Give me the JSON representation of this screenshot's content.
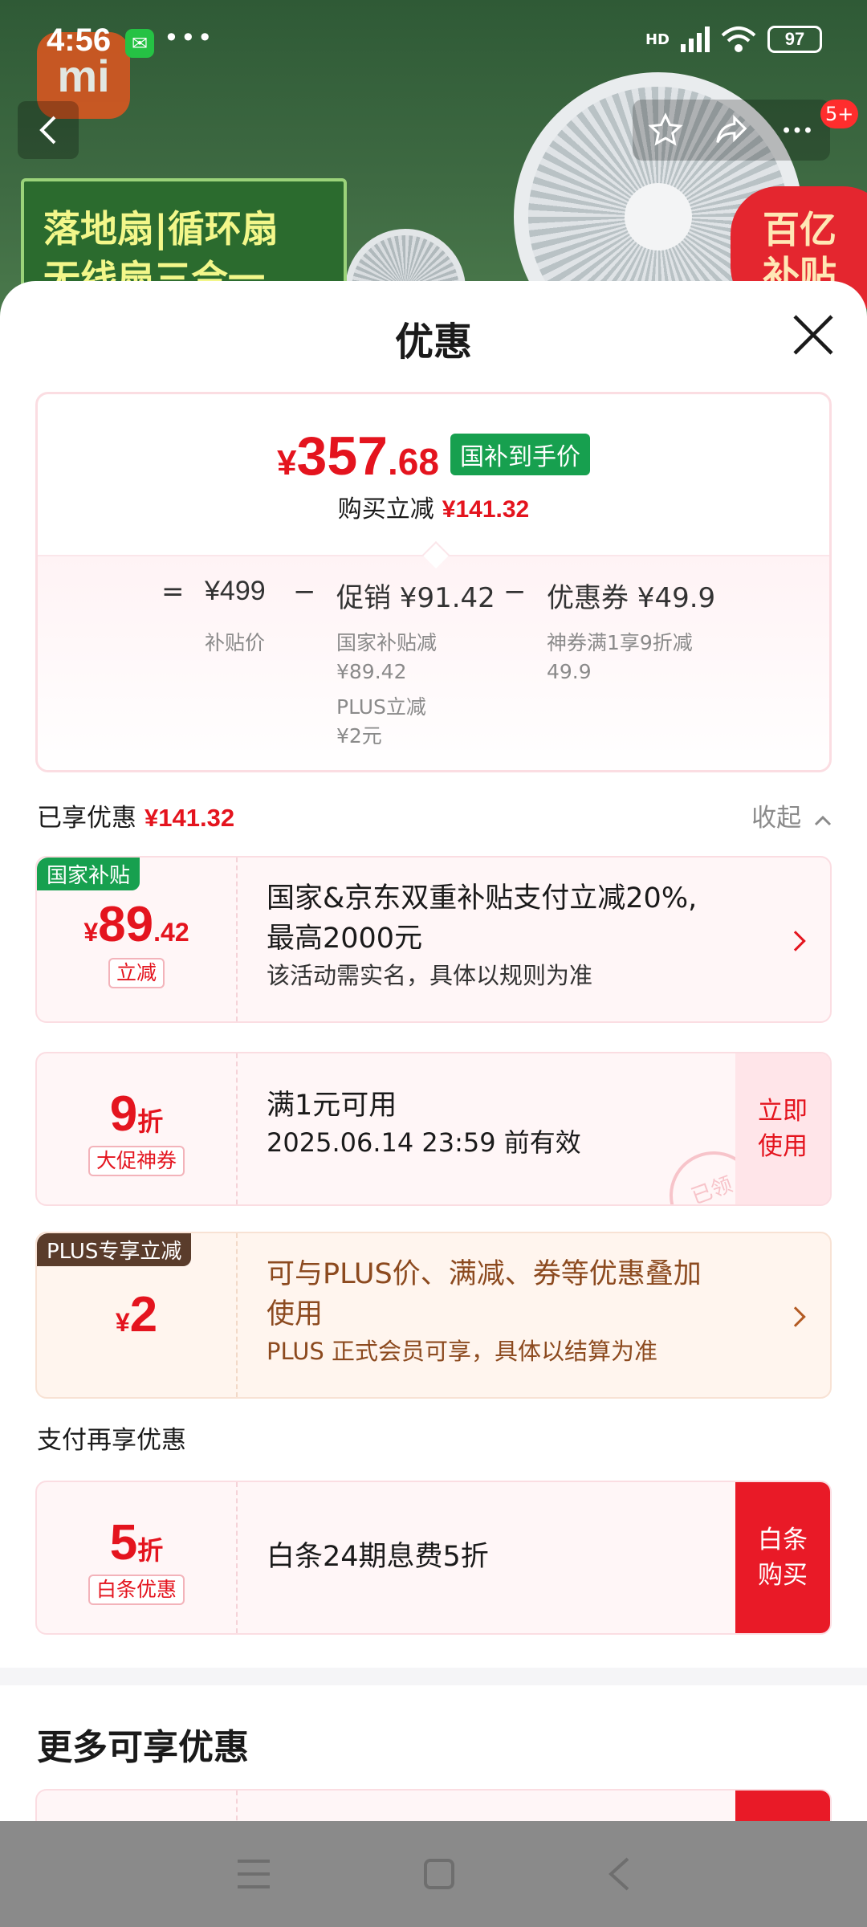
{
  "status_bar": {
    "time": "4:56",
    "network": "HD",
    "battery": "97"
  },
  "background": {
    "brand_logo": "mi",
    "banner_line1": "落地扇|循环扇",
    "banner_line2": "无线扇三合一",
    "badge_line1": "百亿",
    "badge_line2": "补贴",
    "notification_badge": "5+"
  },
  "sheet": {
    "title": "优惠",
    "summary": {
      "currency": "¥",
      "price_int": "357",
      "price_dec": ".68",
      "price_tag": "国补到手价",
      "buy_label": "购买立减",
      "buy_amount": "¥141.32",
      "eq": "=",
      "minus": "−",
      "base_price": "¥499",
      "base_label": "补贴价",
      "promo_amount": "促销 ¥91.42",
      "promo_sub1": "国家补贴减",
      "promo_sub1_val": "¥89.42",
      "promo_sub2": "PLUS立减",
      "promo_sub2_val": "¥2元",
      "coupon_amount": "优惠券 ¥49.9",
      "coupon_sub": "神券满1享9折减",
      "coupon_sub_val": "49.9"
    },
    "enjoyed": {
      "label": "已享优惠",
      "amount": "¥141.32",
      "collapse": "收起"
    },
    "cards": [
      {
        "tag": "国家补贴",
        "currency": "¥",
        "amount_int": "89",
        "amount_dec": ".42",
        "sub_tag": "立减",
        "line1": "国家&京东双重补贴支付立减20%,",
        "line2": "最高2000元",
        "line3": "该活动需实名，具体以规则为准"
      },
      {
        "amount_int": "9",
        "amount_unit": "折",
        "sub_tag": "大促神券",
        "line1": "满1元可用",
        "line2": "2025.06.14 23:59 前有效",
        "action_line1": "立即",
        "action_line2": "使用",
        "stamp": "已领"
      },
      {
        "tag": "PLUS专享立减",
        "currency": "¥",
        "amount_int": "2",
        "line1": "可与PLUS价、满减、券等优惠叠加",
        "line2": "使用",
        "line3": "PLUS 正式会员可享，具体以结算为准"
      }
    ],
    "pay_section": {
      "label": "支付再享优惠"
    },
    "pay_card": {
      "amount_int": "5",
      "amount_unit": "折",
      "sub_tag": "白条优惠",
      "line1": "白条24期息费5折",
      "action_line1": "白条",
      "action_line2": "购买"
    },
    "more_title": "更多可享优惠"
  },
  "colors": {
    "accent_red": "#e4141e",
    "green_tag": "#17a04f",
    "plus_brown": "#5a3c2b"
  }
}
